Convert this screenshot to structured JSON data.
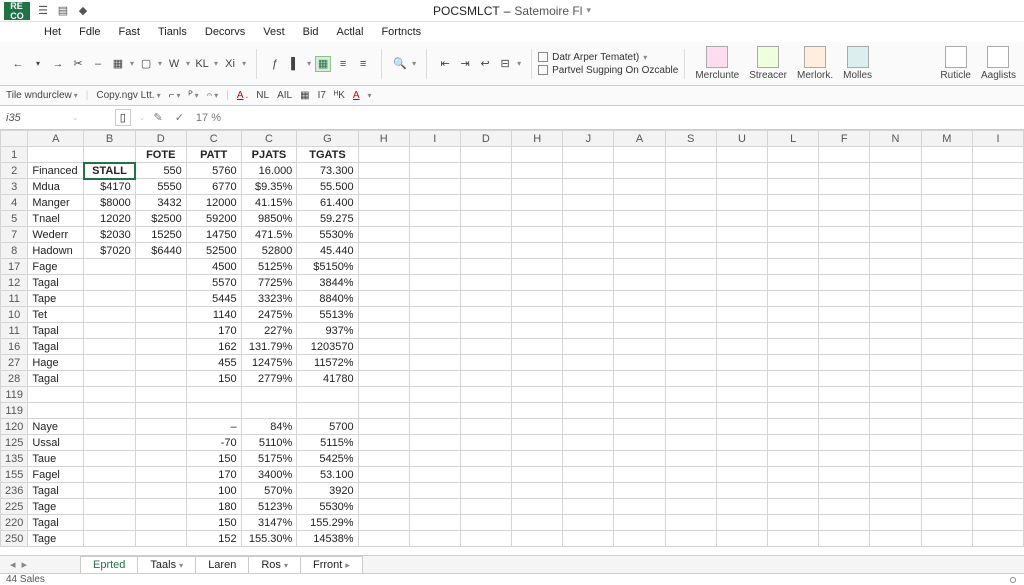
{
  "title": {
    "file": "POCSMLCT",
    "sub": "Satemoire Fl"
  },
  "menu": [
    "Het",
    "Fdle",
    "Fast",
    "Tianls",
    "Decorvs",
    "Vest",
    "Bid",
    "Actlal",
    "Fortncts"
  ],
  "ribbon": {
    "data_text": "Datr Arper Tematet)",
    "partvel": "Partvel Sugping On Ozcable",
    "big": [
      "Merclunte",
      "Streacer",
      "Merlork.",
      "Molles"
    ],
    "far": [
      "Ruticle",
      "Aaglists"
    ]
  },
  "ribbon2": {
    "tile": "Tile wndurclew",
    "copy": "Copy.ngv Ltt."
  },
  "namebox": "i35",
  "zoom": "17 %",
  "columns": [
    "A",
    "B",
    "D",
    "C",
    "C",
    "G",
    "H",
    "I",
    "D",
    "H",
    "J",
    "A",
    "S",
    "U",
    "L",
    "F",
    "N",
    "M",
    "I"
  ],
  "headers": {
    "fote": "FOTE",
    "patt": "PATT",
    "pjats": "PJATS",
    "tgats": "TGATS",
    "stall": "STALL"
  },
  "rows": [
    {
      "n": "1"
    },
    {
      "n": "2",
      "a": "Financed",
      "b": "STALL",
      "d": "550",
      "c1": "5760",
      "c2": "16.000",
      "g": "73.300",
      "active": true
    },
    {
      "n": "3",
      "a": "Mdua",
      "b": "$4170",
      "d": "5550",
      "c1": "6770",
      "c2": "$9.35%",
      "g": "55.500"
    },
    {
      "n": "4",
      "a": "Manger",
      "b": "$8000",
      "d": "3432",
      "c1": "12000",
      "c2": "41.15%",
      "g": "61.400"
    },
    {
      "n": "5",
      "a": "Tnael",
      "b": "12020",
      "d": "$2500",
      "c1": "59200",
      "c2": "9850%",
      "g": "59.275"
    },
    {
      "n": "7",
      "a": "Wederr",
      "b": "$2030",
      "d": "15250",
      "c1": "14750",
      "c2": "471.5%",
      "g": "5530%"
    },
    {
      "n": "8",
      "a": "Hadown",
      "b": "$7020",
      "d": "$6440",
      "c1": "52500",
      "c2": "52800",
      "g": "45.440"
    },
    {
      "n": "17",
      "a": "Fage",
      "c1": "4500",
      "c2": "5125%",
      "g": "$5150%"
    },
    {
      "n": "12",
      "a": "Tagal",
      "c1": "5570",
      "c2": "7725%",
      "g": "3844%"
    },
    {
      "n": "11",
      "a": "Tape",
      "c1": "5445",
      "c2": "3323%",
      "g": "8840%"
    },
    {
      "n": "10",
      "a": "Tet",
      "c1": "1140",
      "c2": "2475%",
      "g": "5513%"
    },
    {
      "n": "11",
      "a": "Tapal",
      "c1": "170",
      "c2": "227%",
      "g": "937%"
    },
    {
      "n": "16",
      "a": "Tagal",
      "c1": "162",
      "c2": "131.79%",
      "g": "1203570"
    },
    {
      "n": "27",
      "a": "Hage",
      "c1": "455",
      "c2": "12475%",
      "g": "11572%"
    },
    {
      "n": "28",
      "a": "Tagal",
      "c1": "150",
      "c2": "2779%",
      "g": "41780"
    },
    {
      "n": "119"
    },
    {
      "n": "119"
    },
    {
      "n": "120",
      "a": "Naye",
      "c1": "–",
      "c2": "84%",
      "g": "5700"
    },
    {
      "n": "125",
      "a": "Ussal",
      "c1": "-70",
      "c2": "5110%",
      "g": "5115%"
    },
    {
      "n": "135",
      "a": "Taue",
      "c1": "150",
      "c2": "5175%",
      "g": "5425%"
    },
    {
      "n": "155",
      "a": "Fagel",
      "c1": "170",
      "c2": "3400%",
      "g": "53.100"
    },
    {
      "n": "236",
      "a": "Tagal",
      "c1": "100",
      "c2": "570%",
      "g": "3920"
    },
    {
      "n": "225",
      "a": "Tage",
      "c1": "180",
      "c2": "5123%",
      "g": "5530%"
    },
    {
      "n": "220",
      "a": "Tagal",
      "c1": "150",
      "c2": "3147%",
      "g": "155.29%"
    },
    {
      "n": "250",
      "a": "Tage",
      "c1": "152",
      "c2": "155.30%",
      "g": "14538%"
    }
  ],
  "tabs": [
    "Eprted",
    "Taals",
    "Laren",
    "Ros",
    "Frront"
  ],
  "status": "44 Sales"
}
